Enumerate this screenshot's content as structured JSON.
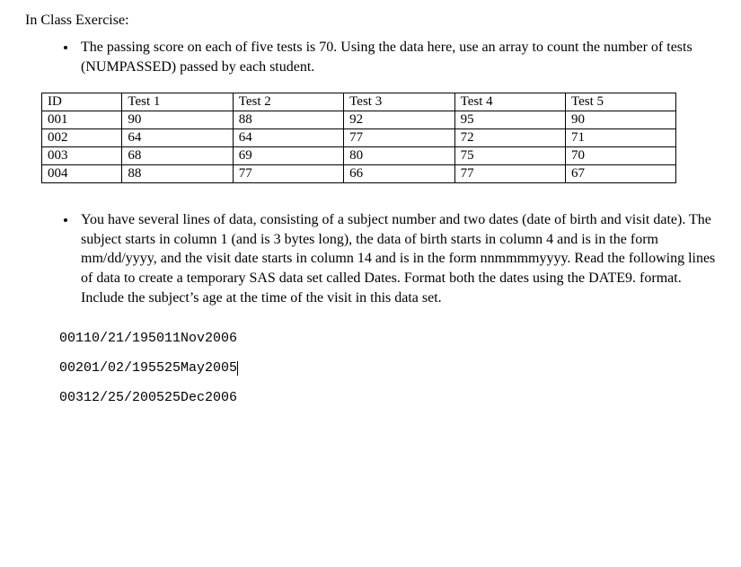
{
  "title": "In Class Exercise:",
  "bullets": {
    "b1": "The passing score on each of five tests is 70.  Using the data here, use an array to count the number of tests (NUMPASSED) passed by each student.",
    "b2": "You have several lines of data, consisting of a subject number and two dates (date of birth and visit date).  The subject starts in column 1 (and is 3 bytes long), the data of birth starts in column 4 and is in the form mm/dd/yyyy, and the visit date starts in column 14 and is in the form nnmmmmyyyy.  Read the following lines of data to create a temporary SAS data set called Dates.  Format both the dates using the DATE9. format.   Include the subject’s age at the time of the visit in this data set."
  },
  "table": {
    "headers": {
      "h0": "ID",
      "h1": "Test 1",
      "h2": "Test 2",
      "h3": "Test 3",
      "h4": "Test 4",
      "h5": "Test 5"
    },
    "rows": [
      {
        "id": "001",
        "t1": "90",
        "t2": "88",
        "t3": "92",
        "t4": "95",
        "t5": "90"
      },
      {
        "id": "002",
        "t1": "64",
        "t2": "64",
        "t3": "77",
        "t4": "72",
        "t5": "71"
      },
      {
        "id": "003",
        "t1": "68",
        "t2": "69",
        "t3": "80",
        "t4": "75",
        "t5": "70"
      },
      {
        "id": "004",
        "t1": "88",
        "t2": "77",
        "t3": "66",
        "t4": "77",
        "t5": "67"
      }
    ]
  },
  "raw": {
    "l1": "00110/21/195011Nov2006",
    "l2": "00201/02/195525May2005",
    "l3": "00312/25/200525Dec2006"
  }
}
